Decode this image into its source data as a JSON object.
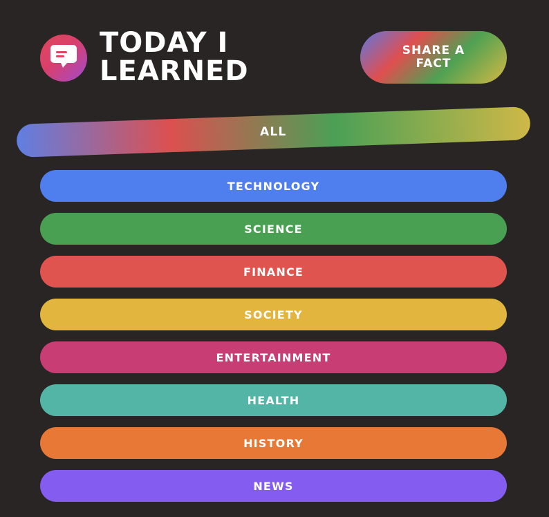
{
  "header": {
    "title_line1": "TODAY I",
    "title_line2": "LEARNED",
    "logo_icon": "chat-bubble-icon"
  },
  "share_button_label": "SHARE A FACT",
  "filters": {
    "all_label": "ALL",
    "categories": [
      {
        "label": "TECHNOLOGY",
        "color": "#4f7fee"
      },
      {
        "label": "SCIENCE",
        "color": "#49a052"
      },
      {
        "label": "FINANCE",
        "color": "#df544e"
      },
      {
        "label": "SOCIETY",
        "color": "#e1b53e"
      },
      {
        "label": "ENTERTAINMENT",
        "color": "#c93d75"
      },
      {
        "label": "HEALTH",
        "color": "#52b5a5"
      },
      {
        "label": "HISTORY",
        "color": "#e77835"
      },
      {
        "label": "NEWS",
        "color": "#845cef"
      }
    ]
  },
  "colors": {
    "background": "#292524",
    "text": "#ffffff"
  }
}
